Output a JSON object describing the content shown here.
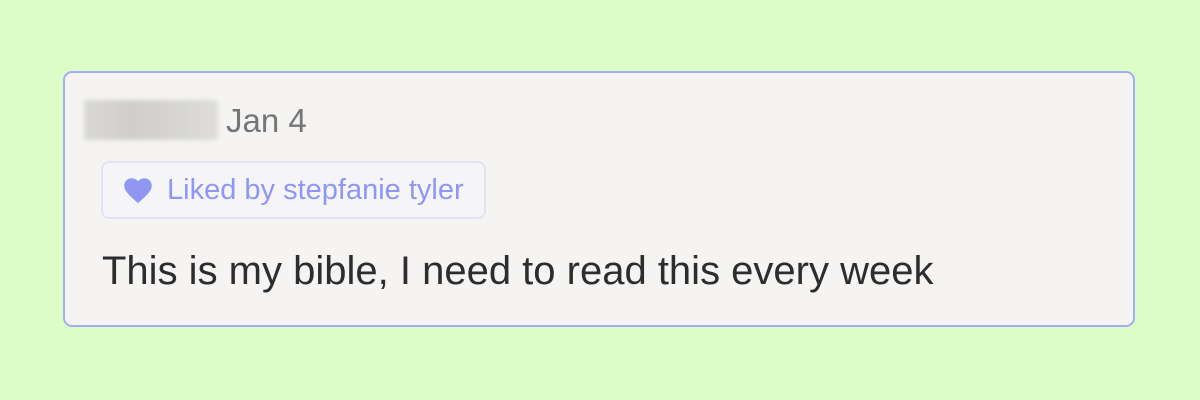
{
  "comment": {
    "date": "Jan 4",
    "liked_by": "Liked by stepfanie tyler",
    "text": "This is my bible, I need to read this every week"
  },
  "icons": {
    "like": "heart-icon"
  },
  "colors": {
    "background": "#dcfcc8",
    "card_background": "#f5f4f2",
    "card_border": "#a3adf6",
    "accent": "#8f97f2",
    "date_text": "#767676",
    "body_text": "#2d2d2d"
  }
}
